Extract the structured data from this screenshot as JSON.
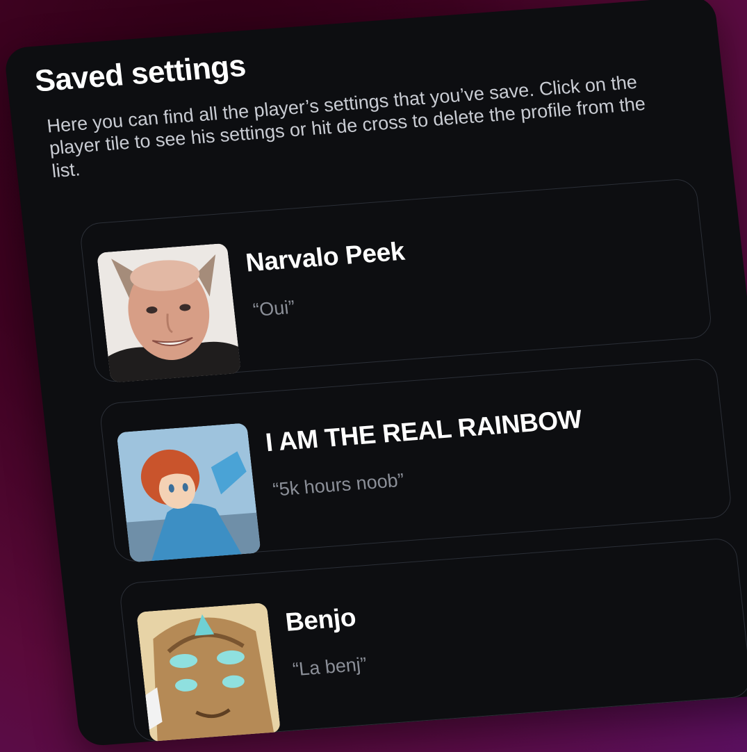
{
  "panel": {
    "title": "Saved settings",
    "description": "Here you can find all the player’s settings that you’ve save. Click on the player tile to see his settings or hit de cross to delete the profile from the list."
  },
  "players": [
    {
      "name": "Narvalo Peek",
      "quote": "“Oui”",
      "avatar": "man-with-cat-ears-photo"
    },
    {
      "name": "I AM THE REAL RAINBOW",
      "quote": "“5k hours noob”",
      "avatar": "anime-girl-red-hair"
    },
    {
      "name": "Benjo",
      "quote": "“La benj”",
      "avatar": "wooden-mask-face"
    }
  ],
  "colors": {
    "background": "#3d0220",
    "card": "#0d0e11",
    "tile_border": "#2b2f37",
    "title": "#ffffff",
    "description": "#c9ccd3",
    "quote": "#8b8f98"
  }
}
